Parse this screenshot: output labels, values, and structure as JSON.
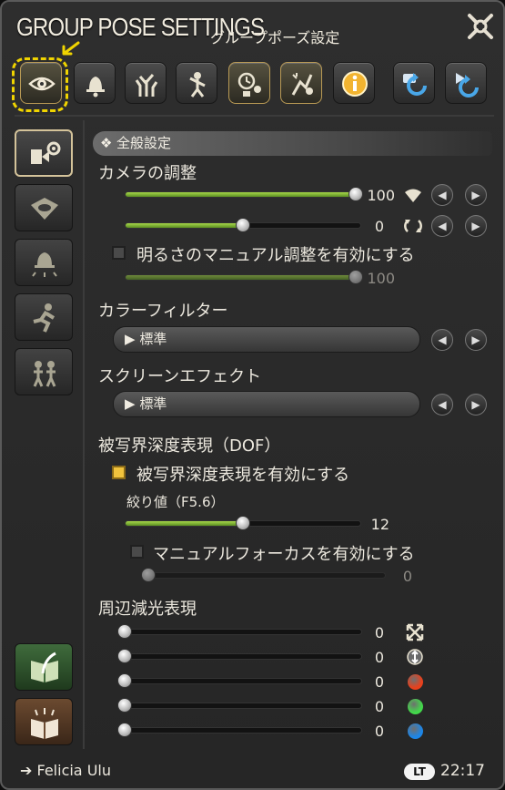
{
  "window": {
    "title": "GROUP POSE SETTINGS",
    "subtitle": "グループポーズ設定"
  },
  "toolbar": {
    "icons": [
      "eye-icon",
      "bell-icon",
      "tree-icon",
      "person-icon",
      "clock-sun-icon",
      "effects-icon",
      "info-icon",
      "refresh-icon",
      "rotate-icon"
    ]
  },
  "section": {
    "header": "全般設定",
    "header_mark": "❖"
  },
  "camera": {
    "label": "カメラの調整",
    "slider1": {
      "value": "100",
      "fill": 0.98
    },
    "slider2": {
      "value": "0",
      "fill": 0.5
    },
    "brightness_checkbox": "明るさのマニュアル調整を有効にする",
    "brightness": {
      "value": "100",
      "fill": 0.98
    }
  },
  "color_filter": {
    "label": "カラーフィルター",
    "selected": "標準"
  },
  "screen_effect": {
    "label": "スクリーンエフェクト",
    "selected": "標準"
  },
  "dof": {
    "label": "被写界深度表現（DOF）",
    "enable_checkbox": "被写界深度表現を有効にする",
    "aperture_label": "絞り値（F5.6）",
    "aperture": {
      "value": "12",
      "fill": 0.5
    },
    "manual_focus_checkbox": "マニュアルフォーカスを有効にする",
    "focus": {
      "value": "0",
      "fill": 0
    }
  },
  "vignette": {
    "label": "周辺減光表現",
    "rows": [
      {
        "value": "0"
      },
      {
        "value": "0"
      },
      {
        "value": "0"
      },
      {
        "value": "0"
      },
      {
        "value": "0"
      }
    ],
    "colors": [
      "#e8401c",
      "#42d84a",
      "#1c86e8"
    ]
  },
  "footer": {
    "player": "Felicia Ulu",
    "badge": "LT",
    "time": "22:17"
  }
}
